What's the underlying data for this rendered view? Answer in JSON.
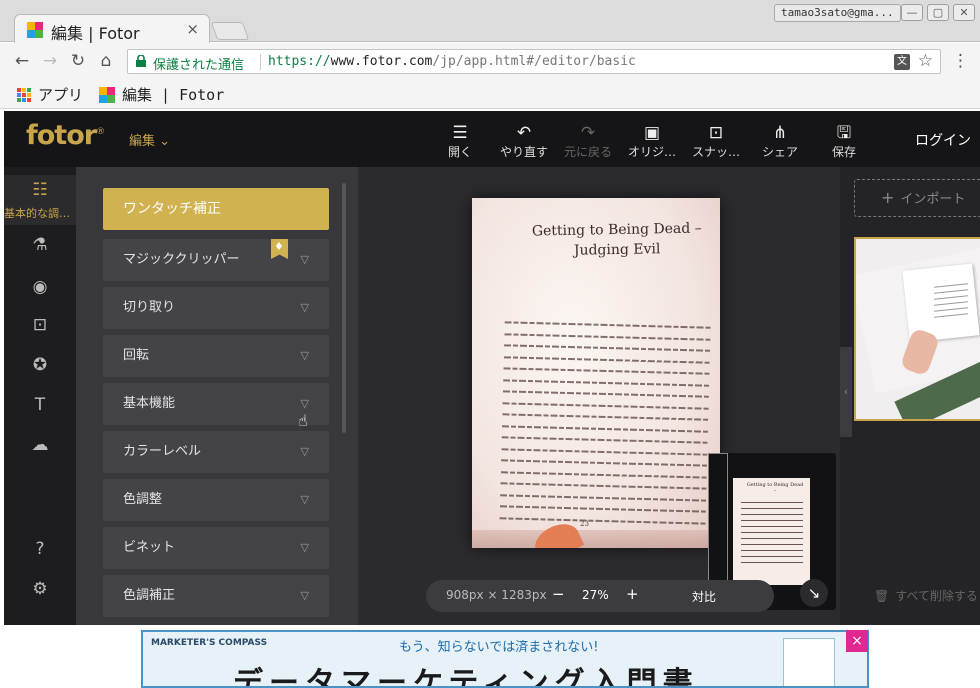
{
  "browser": {
    "tab_title": "編集 | Fotor",
    "tab_close": "×",
    "profile": "tamao3sato@gma...",
    "window_controls": [
      "—",
      "▢",
      "✕"
    ],
    "secure_label": "保護された通信",
    "url_scheme": "https://",
    "url_host": "www.fotor.com",
    "url_path": "/jp/app.html#/editor/basic",
    "bookmarks": [
      {
        "label": "アプリ",
        "icon": "apps-grid-icon"
      },
      {
        "label": "編集 | Fotor",
        "icon": "fotor-favicon-icon"
      }
    ]
  },
  "app": {
    "logo": "fotor",
    "logo_mark": "®",
    "edit_menu": "編集",
    "header_actions": [
      {
        "label": "開く",
        "icon": "menu-icon",
        "enabled": true
      },
      {
        "label": "やり直す",
        "icon": "undo-icon",
        "enabled": true
      },
      {
        "label": "元に戻る",
        "icon": "redo-icon",
        "enabled": false
      },
      {
        "label": "オリジ…",
        "icon": "image-icon",
        "enabled": true
      },
      {
        "label": "スナッ…",
        "icon": "snapshot-icon",
        "enabled": true
      },
      {
        "label": "シェア",
        "icon": "share-icon",
        "enabled": true
      },
      {
        "label": "保存",
        "icon": "save-icon",
        "enabled": true
      }
    ],
    "login": "ログイン",
    "rail": {
      "active_label": "基本的な調…",
      "icons": [
        "sliders-icon",
        "flask-icon",
        "eye-icon",
        "frame-icon",
        "sticker-icon",
        "text-icon",
        "cloud-upload-icon",
        "help-icon",
        "settings-icon"
      ]
    },
    "panel": {
      "primary": "ワンタッチ補正",
      "items": [
        "マジッククリッパー",
        "切り取り",
        "回転",
        "基本機能",
        "カラーレベル",
        "色調整",
        "ビネット",
        "色調補正"
      ]
    },
    "document": {
      "title_line1": "Getting to Being Dead –",
      "title_line2": "Judging Evil",
      "page_number": "23"
    },
    "zoom": {
      "dimensions": "908px × 1283px",
      "minus": "−",
      "percent": "27%",
      "plus": "+",
      "compare": "対比"
    },
    "right": {
      "import": "インポート",
      "delete_all": "すべて削除する"
    }
  },
  "ad": {
    "brand": "MARKETER'S COMPASS",
    "tagline": "もう、知らないでは済まされない!",
    "headline": "データマーケティング入門書",
    "close": "×"
  },
  "colors": {
    "accent_gold": "#d0b251",
    "app_bg": "#2b2b2e",
    "secure_green": "#0b8043"
  }
}
